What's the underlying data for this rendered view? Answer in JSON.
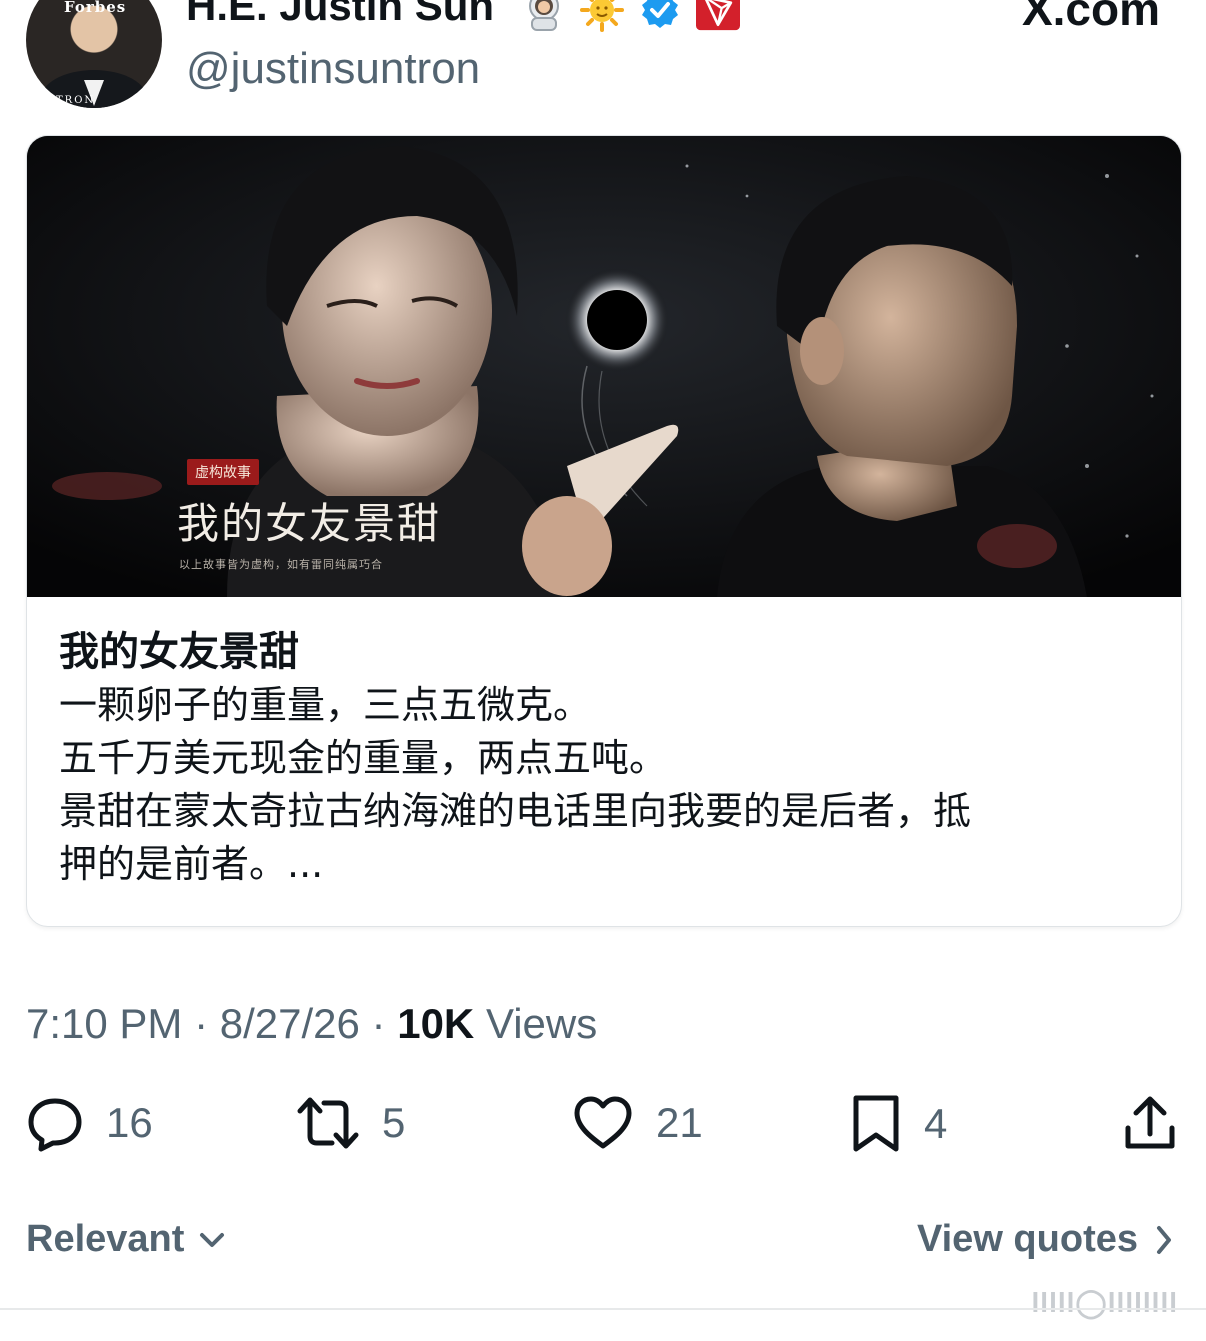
{
  "header": {
    "avatar_text_top": "Forbes",
    "avatar_text_bottom": "TRON",
    "display_name": "H.E. Justin Sun",
    "badges": [
      "astronaut-emoji",
      "sun-emoji",
      "verified-badge",
      "tron-badge"
    ],
    "handle": "@justinsuntron",
    "site": "X.com"
  },
  "card": {
    "image": {
      "tag": "虚构故事",
      "title": "我的女友景甜",
      "note": "以上故事皆为虚构，如有雷同纯属巧合"
    },
    "title": "我的女友景甜",
    "description_lines": [
      "一颗卵子的重量，三点五微克。",
      "五千万美元现金的重量，两点五吨。",
      "景甜在蒙太奇拉古纳海滩的电话里向我要的是后者，抵",
      "押的是前者。..."
    ]
  },
  "meta": {
    "time": "7:10 PM",
    "sep1": " · ",
    "date": "8/27/26",
    "sep2": " · ",
    "views_count": "10K",
    "views_label": " Views"
  },
  "actions": {
    "replies": "16",
    "reposts": "5",
    "likes": "21",
    "bookmarks": "4"
  },
  "footer": {
    "sort_label": "Relevant",
    "view_quotes_label": "View quotes",
    "watermark": "lllll◯llllllll"
  },
  "colors": {
    "text_primary": "#0f1419",
    "text_secondary": "#536471",
    "verified_blue": "#1d9bf0",
    "tron_red": "#d3202b"
  }
}
